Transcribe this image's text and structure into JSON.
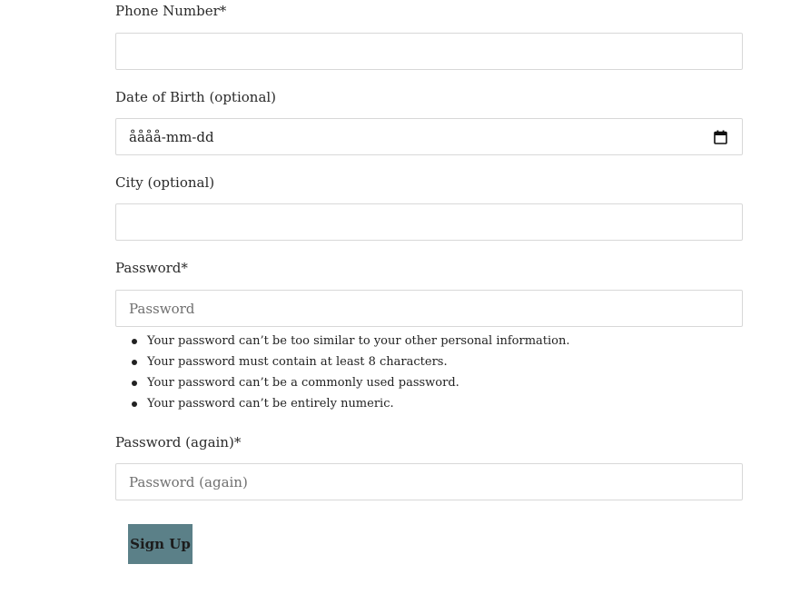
{
  "form": {
    "phone": {
      "label": "Phone Number*",
      "value": ""
    },
    "dob": {
      "label": "Date of Birth (optional)",
      "value": "åååå-mm-dd"
    },
    "city": {
      "label": "City (optional)",
      "value": ""
    },
    "password": {
      "label": "Password*",
      "placeholder": "Password",
      "help": [
        "Your password can’t be too similar to your other personal information.",
        "Your password must contain at least 8 characters.",
        "Your password can’t be a commonly used password.",
        "Your password can’t be entirely numeric."
      ]
    },
    "password2": {
      "label": "Password (again)*",
      "placeholder": "Password (again)"
    },
    "submit_label": "Sign Up"
  },
  "icons": {
    "date_picker": "calendar-icon"
  }
}
